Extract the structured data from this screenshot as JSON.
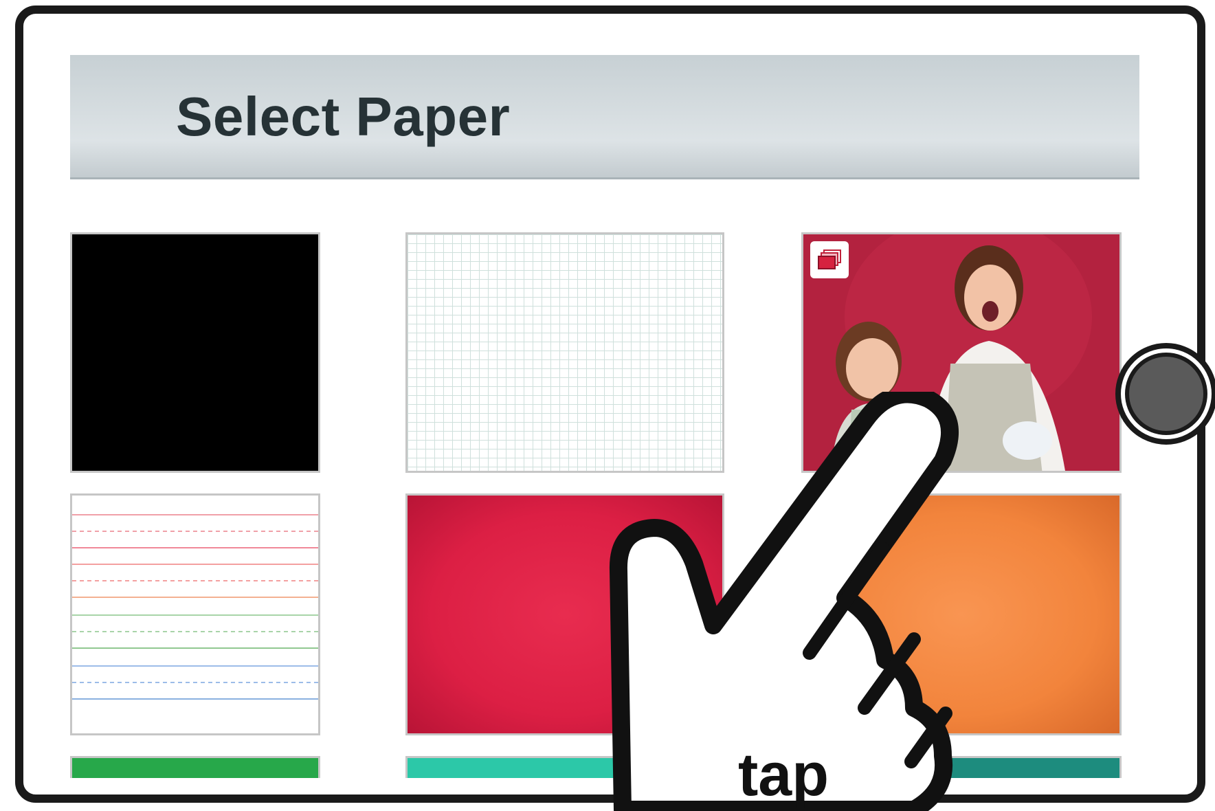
{
  "header": {
    "title": "Select Paper"
  },
  "papers": [
    {
      "name": "Black",
      "color": "#000000"
    },
    {
      "name": "Grid",
      "color": "#ffffff"
    },
    {
      "name": "Photo",
      "color": "#b3223f",
      "icon": "photo-library-icon"
    },
    {
      "name": "Lined",
      "color": "#ffffff"
    },
    {
      "name": "Red",
      "color": "#dc1f44"
    },
    {
      "name": "Orange",
      "color": "#f2843c"
    },
    {
      "name": "Green",
      "color": "#27a84a"
    },
    {
      "name": "Teal",
      "color": "#2cc8a8"
    },
    {
      "name": "Dark Teal",
      "color": "#1d8c7e"
    }
  ],
  "gesture": {
    "label": "tap",
    "icon": "pointing-hand-icon"
  },
  "device": {
    "button_icon": "home-button-icon"
  }
}
